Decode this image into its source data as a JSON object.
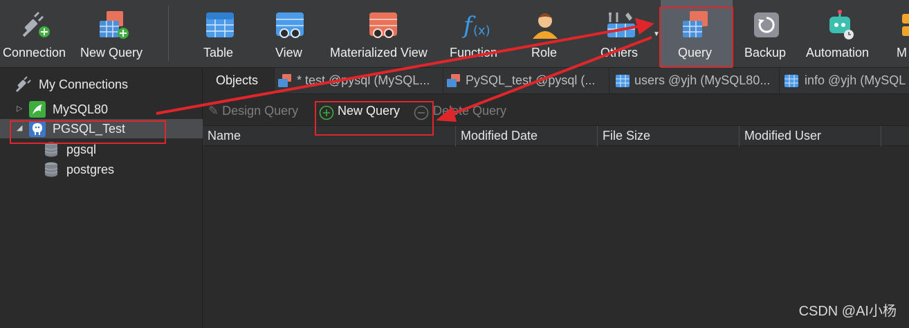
{
  "toolbar": {
    "connection": "Connection",
    "new_query": "New Query",
    "table": "Table",
    "view": "View",
    "materialized_view": "Materialized View",
    "function": "Function",
    "role": "Role",
    "others": "Others",
    "query": "Query",
    "backup": "Backup",
    "automation": "Automation",
    "more_partial": "M"
  },
  "sidebar": {
    "root": "My Connections",
    "connections": [
      {
        "name": "MySQL80"
      },
      {
        "name": "PGSQL_Test",
        "databases": [
          "pgsql",
          "postgres"
        ]
      }
    ]
  },
  "tabs": [
    "Objects",
    "* test @pysql (MySQL...",
    "PySQL_test @pysql (...",
    "users @yjh (MySQL80...",
    "info @yjh (MySQL"
  ],
  "object_toolbar": {
    "design_query": "Design Query",
    "new_query": "New Query",
    "delete_query": "Delete Query"
  },
  "columns": [
    "Name",
    "Modified Date",
    "File Size",
    "Modified User"
  ],
  "watermark": "CSDN @AI小杨",
  "colors": {
    "annotation": "#e0262a",
    "active_toolbar": "#5a5f66"
  }
}
